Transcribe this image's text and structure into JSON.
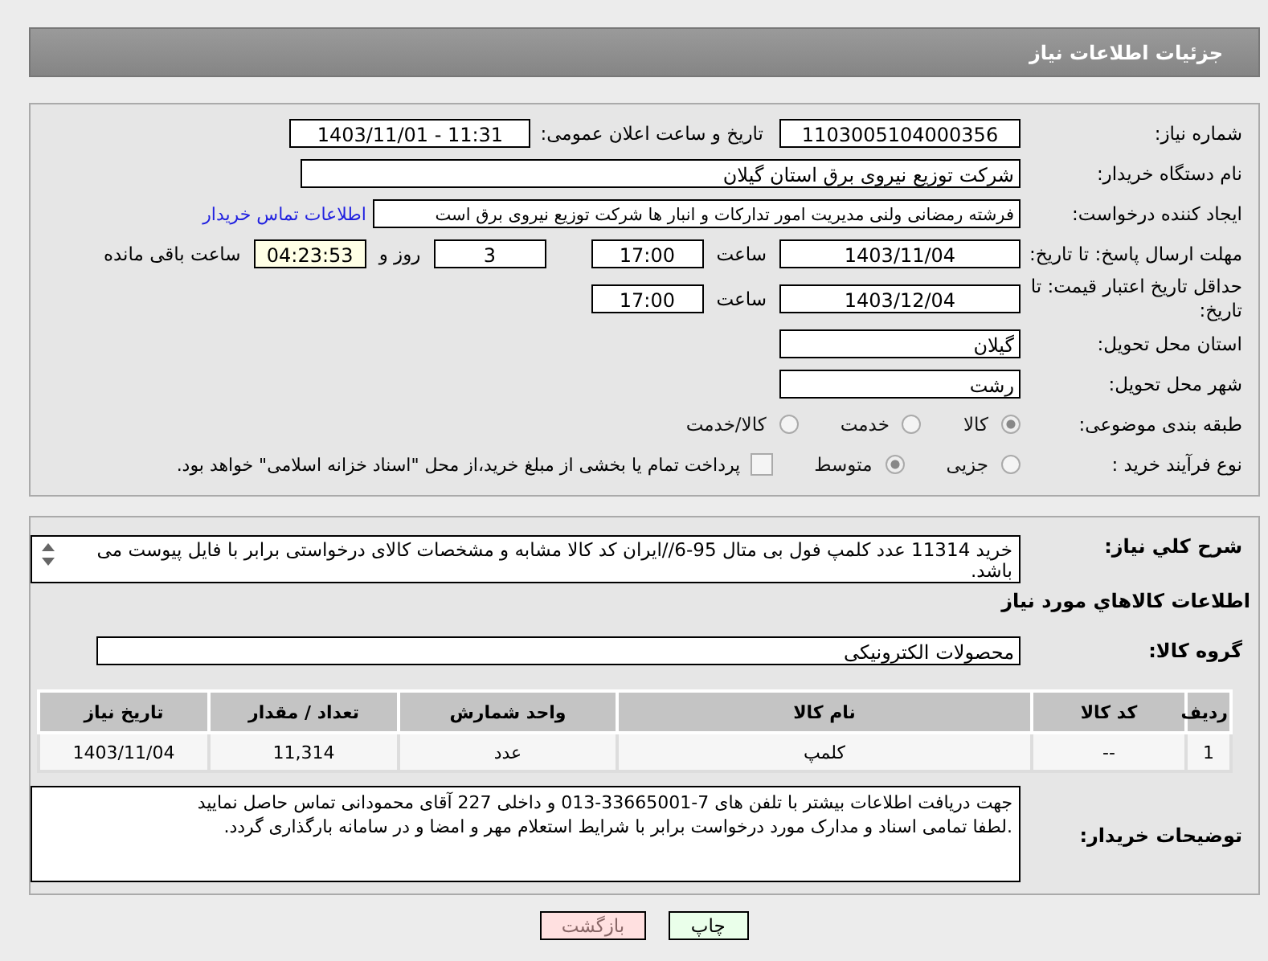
{
  "header": {
    "title": "جزئیات اطلاعات نیاز"
  },
  "need_number": {
    "label": "شماره نیاز:",
    "value": "1103005104000356"
  },
  "announce": {
    "label": "تاریخ و ساعت اعلان عمومی:",
    "value": "1403/11/01 - 11:31"
  },
  "buyer": {
    "label": "نام دستگاه خریدار:",
    "value": "شرکت توزیع نیروی برق استان گیلان"
  },
  "creator": {
    "label": "ایجاد کننده درخواست:",
    "value": "فرشته رمضانی ولنی مدیریت امور تدارکات و انبار ها شرکت توزیع نیروی برق است",
    "link": "اطلاعات تماس خریدار"
  },
  "deadline": {
    "label": "مهلت ارسال پاسخ: تا تاریخ:",
    "date": "1403/11/04",
    "time_label": "ساعت",
    "time": "17:00",
    "days": "3",
    "days_label": "روز و",
    "remaining": "04:23:53",
    "remaining_label": "ساعت باقی مانده"
  },
  "validity": {
    "label": "حداقل تاریخ اعتبار قیمت: تا تاریخ:",
    "date": "1403/12/04",
    "time_label": "ساعت",
    "time": "17:00"
  },
  "province": {
    "label": "استان محل تحویل:",
    "value": "گیلان"
  },
  "city": {
    "label": "شهر محل تحویل:",
    "value": "رشت"
  },
  "category": {
    "label": "طبقه بندی موضوعی:",
    "options": [
      {
        "label": "کالا",
        "selected": true
      },
      {
        "label": "خدمت",
        "selected": false
      },
      {
        "label": "کالا/خدمت",
        "selected": false
      }
    ]
  },
  "process": {
    "label": "نوع فرآیند خرید :",
    "options": [
      {
        "label": "جزیی",
        "selected": false
      },
      {
        "label": "متوسط",
        "selected": true
      }
    ],
    "treasury": {
      "checked": false,
      "label": "پرداخت تمام یا بخشی از مبلغ خرید،از محل \"اسناد خزانه اسلامی\" خواهد بود."
    }
  },
  "summary": {
    "label": "شرح کلي نياز:",
    "value": "خرید 11314 عدد کلمپ فول بی متال 95-6//ایران کد کالا مشابه و مشخصات کالای درخواستی برابر با فایل پیوست می باشد."
  },
  "goods_heading": "اطلاعات کالاهاي مورد نياز",
  "goods_group": {
    "label": "گروه کالا:",
    "value": "محصولات الکترونیکی"
  },
  "table": {
    "columns": [
      "رديف",
      "کد کالا",
      "نام کالا",
      "واحد شمارش",
      "تعداد / مقدار",
      "تاریخ نیاز"
    ],
    "rows": [
      [
        "1",
        "--",
        "کلمپ",
        "عدد",
        "11,314",
        "1403/11/04"
      ]
    ]
  },
  "notes": {
    "label": "توضیحات خریدار:",
    "lines": [
      "جهت دریافت اطلاعات بیشتر با تلفن های 7-33665001-013 و داخلی 227 آقای محمودانی تماس حاصل نمایید",
      ".لطفا تمامی اسناد و مدارک مورد درخواست برابر با شرایط استعلام مهر و امضا و در سامانه بارگذاری گردد."
    ]
  },
  "buttons": [
    {
      "label": "چاپ",
      "kind": "print"
    },
    {
      "label": "بازگشت",
      "kind": "back"
    }
  ]
}
